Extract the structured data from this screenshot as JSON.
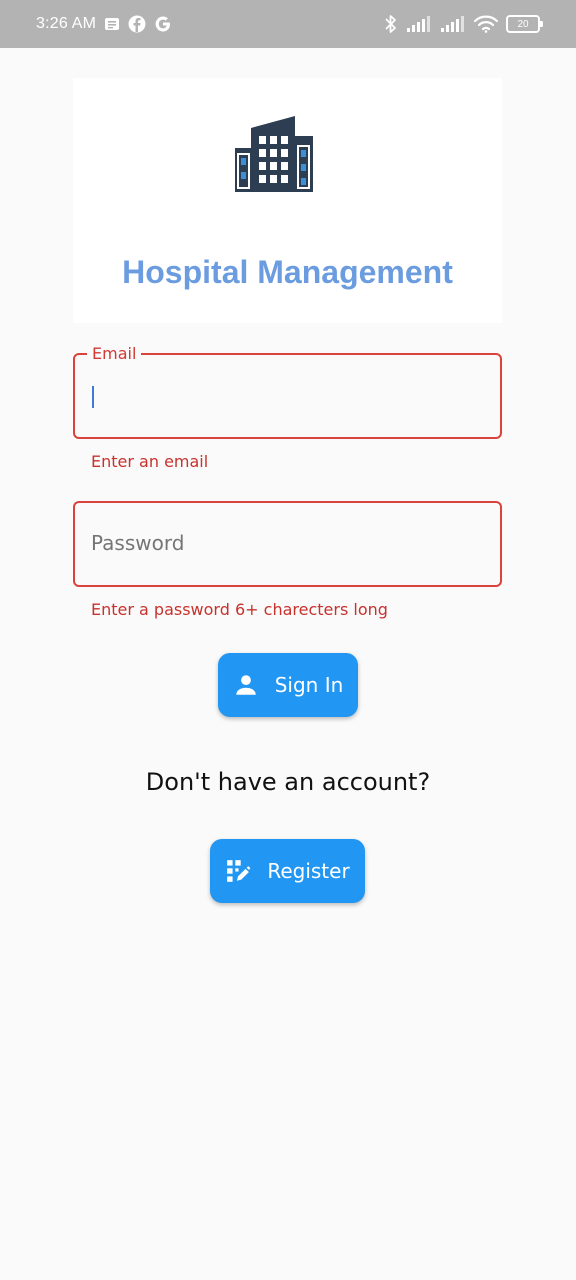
{
  "status_bar": {
    "time": "3:26 AM",
    "battery": "20",
    "left_icons": [
      "notes-icon",
      "facebook-icon",
      "google-icon"
    ],
    "right_icons": [
      "bluetooth-icon",
      "signal-icon",
      "signal-icon",
      "wifi-icon",
      "battery-icon"
    ]
  },
  "header": {
    "title": "Hospital Management",
    "logo_icon": "hospital-building-icon",
    "title_color": "#6c9ce0"
  },
  "form": {
    "email": {
      "label": "Email",
      "value": "",
      "error": "Enter an email"
    },
    "password": {
      "placeholder": "Password",
      "value": "",
      "error": "Enter a password 6+ charecters long"
    },
    "error_color": "#d9433b"
  },
  "actions": {
    "sign_in_label": "Sign In",
    "sign_in_icon": "person-icon",
    "account_prompt": "Don't have an account?",
    "register_label": "Register",
    "register_icon": "app-registration-icon",
    "button_color": "#2196f3"
  }
}
